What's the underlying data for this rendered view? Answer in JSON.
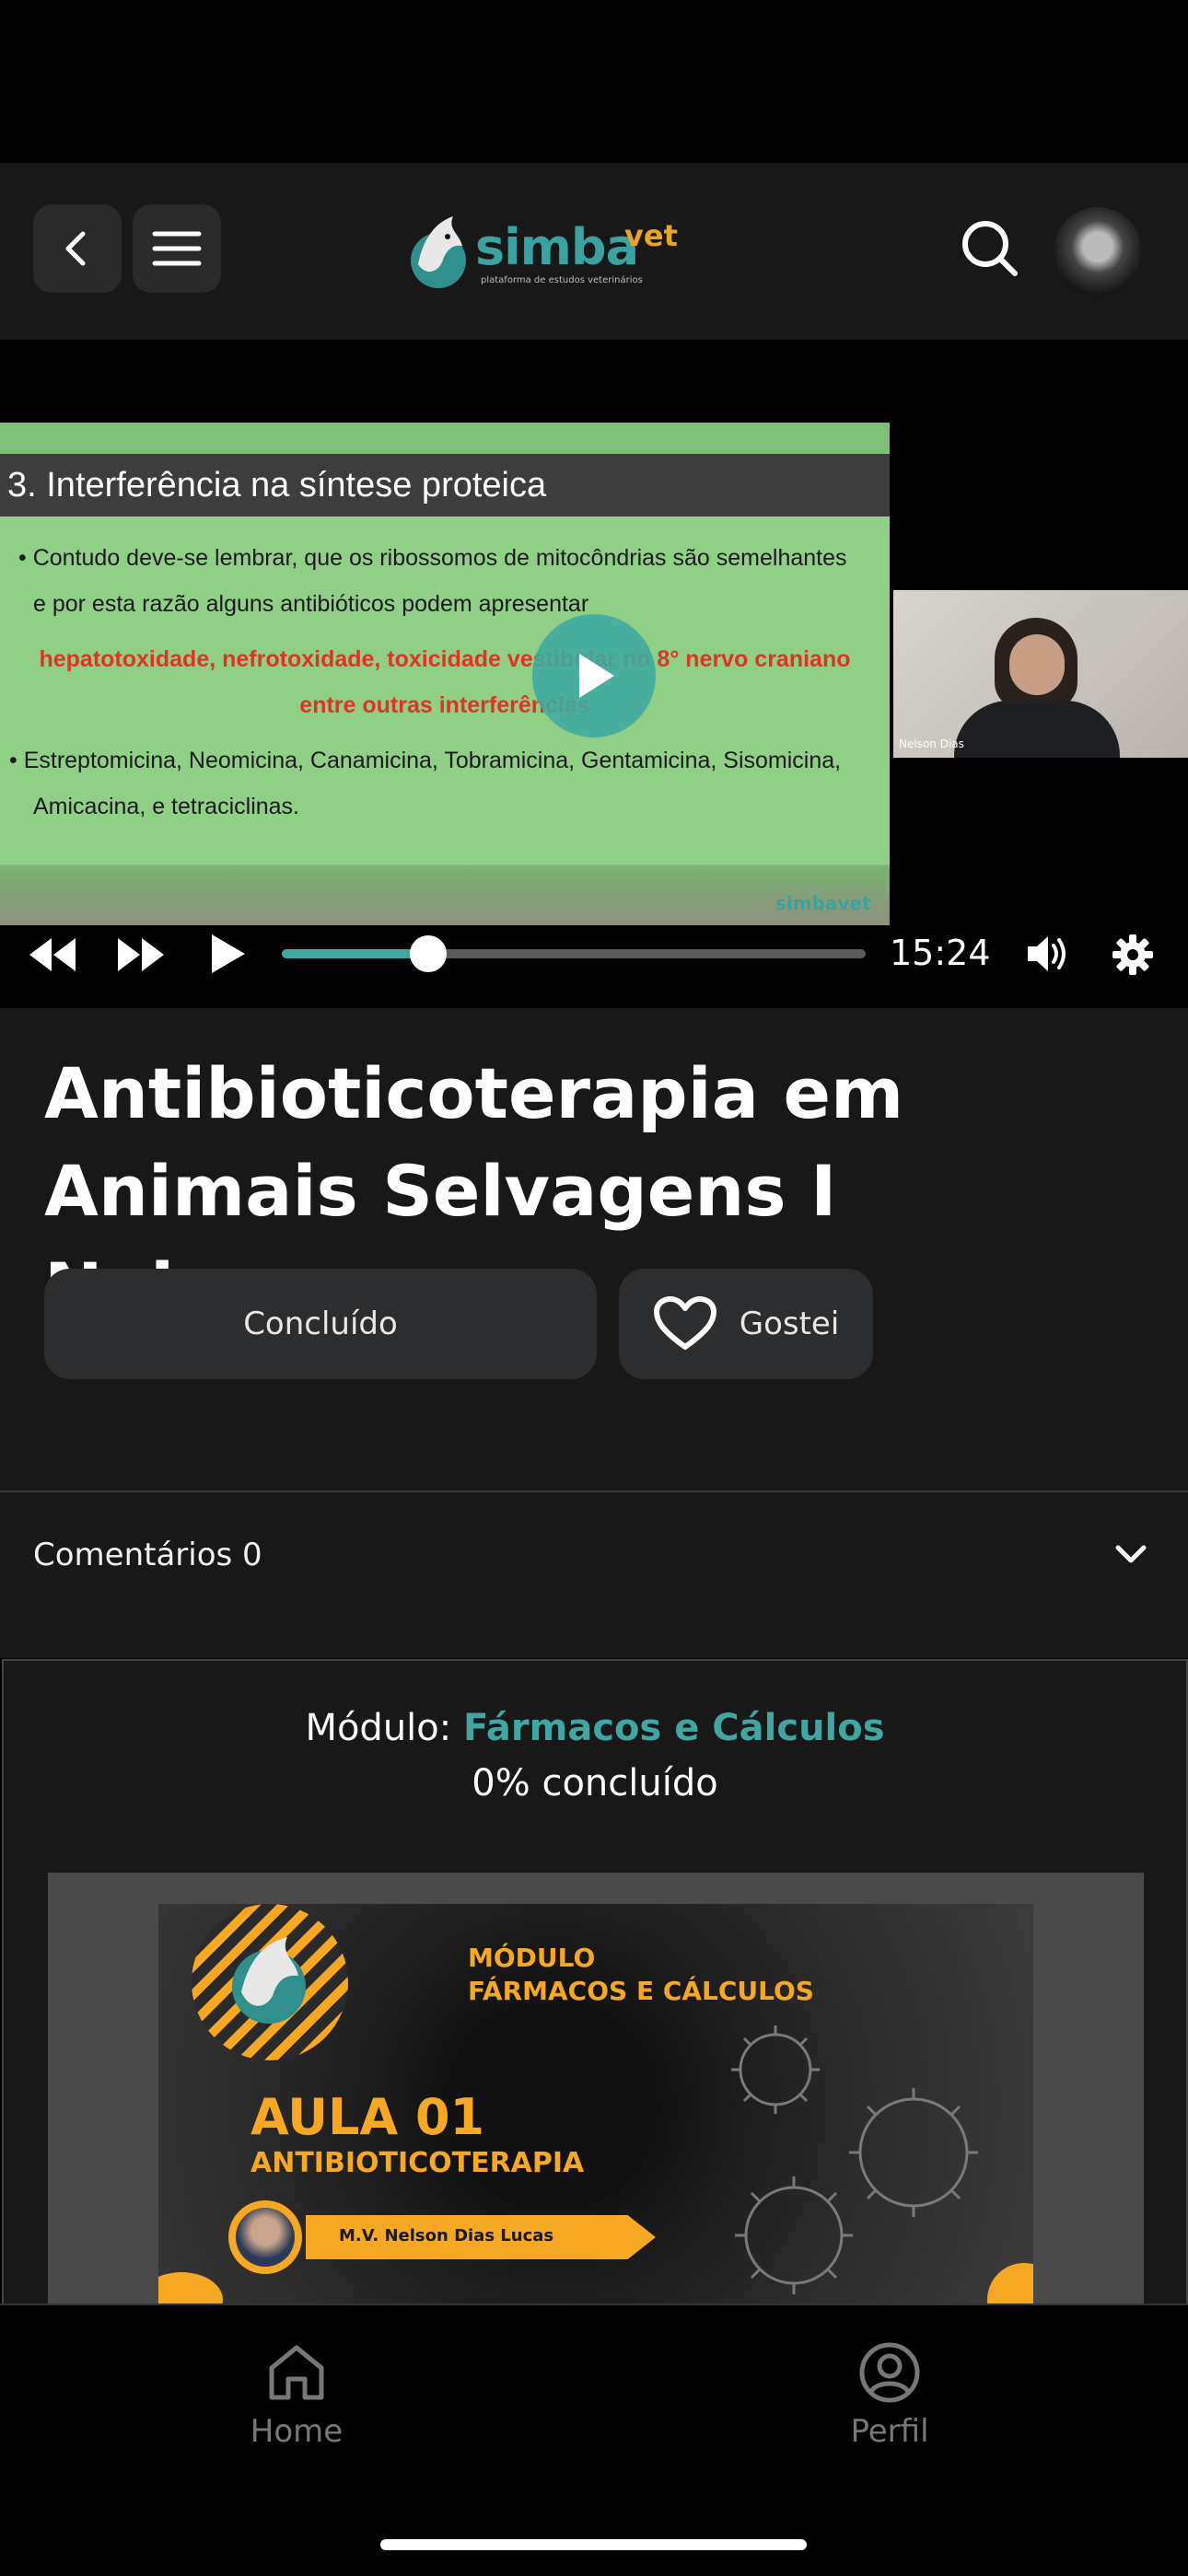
{
  "header": {
    "back_label": "",
    "menu_label": "",
    "logo_main": "simba",
    "logo_accent": "vet",
    "logo_tagline": "plataforma de estudos veterinários"
  },
  "video": {
    "slide_title": "3. Interferência na síntese proteica",
    "slide_bullet1_line1": "•   Contudo deve-se lembrar, que os ribossomos de mitocôndrias são semelhantes",
    "slide_bullet1_line2": "e por esta razão alguns antibióticos podem apresentar",
    "slide_red_line1": "hepatotoxidade, nefrotoxidade, toxicidade vestibular no 8° nervo craniano",
    "slide_red_line2": "entre outras interferências",
    "slide_bullet2_line1": "• Estreptomicina, Neomicina, Canamicina, Tobramicina, Gentamicina, Sisomicina,",
    "slide_bullet2_line2": "Amicacina, e tetraciclinas.",
    "slide_watermark": "simbavet",
    "pip_name": "Nelson Dias",
    "time": "15:24",
    "progress": 0.25
  },
  "lesson": {
    "title": "Antibioticoterapia em Animais Selvagens I Nelson...",
    "concluded_label": "Concluído",
    "like_label": "Gostei"
  },
  "comments": {
    "label": "Comentários 0"
  },
  "module": {
    "prefix": "Módulo: ",
    "name": "Fármacos e Cálculos",
    "progress_text": "0% concluído",
    "thumb_heading_line1": "MÓDULO",
    "thumb_heading_line2": "FÁRMACOS E CÁLCULOS",
    "thumb_aula": "AULA 01",
    "thumb_topic": "ANTIBIOTICOTERAPIA",
    "thumb_presenter": "M.V. Nelson Dias Lucas"
  },
  "nav": {
    "home_label": "Home",
    "profile_label": "Perfil"
  },
  "colors": {
    "accent": "#40a6a2",
    "background": "#181818",
    "orange": "#f7a823"
  }
}
